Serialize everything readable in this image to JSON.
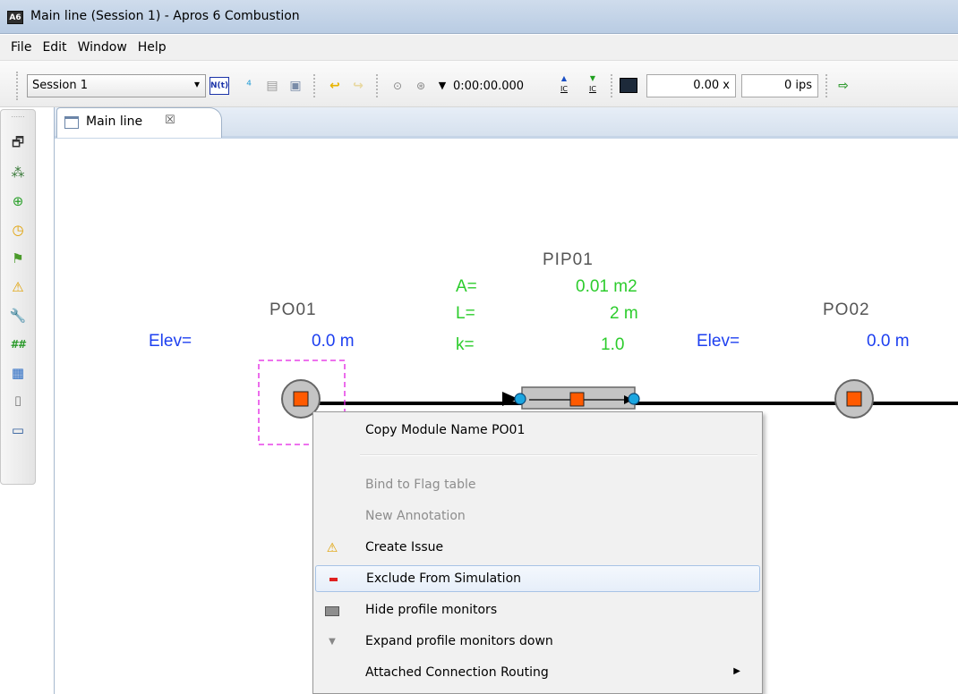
{
  "window": {
    "app_icon_text": "A6",
    "title": "Main line (Session 1) - Apros 6 Combustion"
  },
  "menu": [
    "File",
    "Edit",
    "Window",
    "Help"
  ],
  "toolbar": {
    "session": "Session 1",
    "nu_label": "N(t)",
    "time": "0:00:00.000",
    "ic_up": "IC",
    "ic_down": "IC",
    "speed": "0.00 x",
    "ips": "0 ips"
  },
  "tab": {
    "label": "Main line",
    "close": "☒"
  },
  "diagram": {
    "po01": {
      "name": "PO01",
      "elev_label": "Elev=",
      "elev_value": "0.0 m"
    },
    "pip01": {
      "name": "PIP01",
      "a_label": "A=",
      "a_value": "0.01 m2",
      "l_label": "L=",
      "l_value": "2 m",
      "k_label": "k=",
      "k_value": "1.0"
    },
    "po02": {
      "name": "PO02",
      "elev_label": "Elev=",
      "elev_value": "0.0 m"
    }
  },
  "context_menu": {
    "items": [
      {
        "label": "Copy Module Name PO01",
        "icon": "",
        "enabled": true
      },
      {
        "label": "Bind to Flag table",
        "icon": "",
        "enabled": false
      },
      {
        "label": "New Annotation",
        "icon": "",
        "enabled": false
      },
      {
        "label": "Create Issue",
        "icon": "warning-icon",
        "enabled": true
      },
      {
        "label": "Exclude From Simulation",
        "icon": "minus-icon",
        "enabled": true,
        "highlighted": true
      },
      {
        "label": "Hide profile monitors",
        "icon": "profile-monitor-icon",
        "enabled": true
      },
      {
        "label": "Expand profile monitors down",
        "icon": "triangle-down-icon",
        "enabled": true
      },
      {
        "label": "Attached Connection Routing",
        "icon": "",
        "enabled": true,
        "submenu": true
      }
    ]
  },
  "colors": {
    "label_blue": "#1d3ff0",
    "label_green": "#2ccc2c",
    "node_orange": "#ff5a00",
    "port_cyan": "#1ba6e0",
    "selection_magenta": "#e21ee2"
  }
}
